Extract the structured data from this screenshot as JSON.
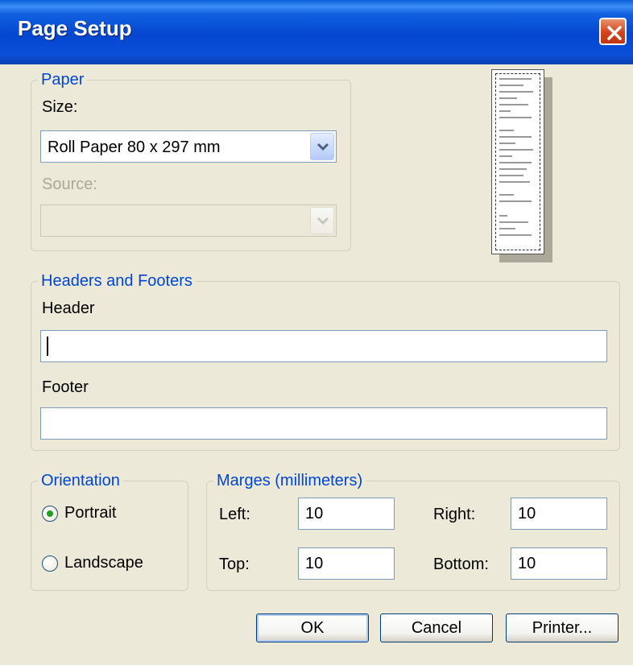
{
  "window": {
    "title": "Page Setup"
  },
  "paper": {
    "legend": "Paper",
    "size_label": "Size:",
    "size_value": "Roll Paper 80 x 297 mm",
    "source_label": "Source:",
    "source_value": ""
  },
  "headers_footers": {
    "legend": "Headers and Footers",
    "header_label": "Header",
    "header_value": "",
    "footer_label": "Footer",
    "footer_value": ""
  },
  "orientation": {
    "legend": "Orientation",
    "options": [
      {
        "label": "Portrait",
        "selected": true
      },
      {
        "label": "Landscape",
        "selected": false
      }
    ]
  },
  "margins": {
    "legend": "Marges (millimeters)",
    "left_label": "Left:",
    "left_value": "10",
    "right_label": "Right:",
    "right_value": "10",
    "top_label": "Top:",
    "top_value": "10",
    "bottom_label": "Bottom:",
    "bottom_value": "10"
  },
  "buttons": {
    "ok": "OK",
    "cancel": "Cancel",
    "printer": "Printer..."
  },
  "colors": {
    "dialog_background": "#ECE9D8",
    "titlebar": "#0446CF",
    "group_legend": "#0046D5",
    "close_button": "#D0431C",
    "radio_dot": "#21A121"
  },
  "icons": {
    "close": "close-x-icon",
    "dropdown": "chevron-down-icon"
  }
}
